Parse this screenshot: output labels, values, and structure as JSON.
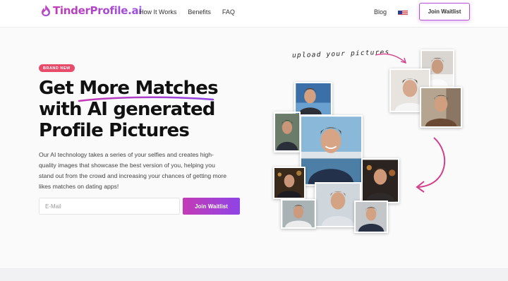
{
  "brand": {
    "name": "TinderProfile.ai",
    "color": "#b44fd8"
  },
  "nav": {
    "how": "How It Works",
    "benefits": "Benefits",
    "faq": "FAQ",
    "blog": "Blog"
  },
  "header": {
    "cta": "Join Waitlist",
    "language_icon": "us-flag-icon"
  },
  "hero": {
    "badge": "BRAND NEW",
    "headline_line1": "Get More Matches",
    "headline_line2": "with AI generated",
    "headline_line3": "Profile Pictures",
    "description": "Our AI technology takes a series of your selfies and creates high-quality images that showcase the best version of you, helping you stand out from the crowd and increasing your chances of getting more likes matches on dating apps!",
    "email_placeholder": "E-Mail",
    "cta": "Join Waitlist"
  },
  "collage": {
    "upload_label": "upload your pictures"
  },
  "colors": {
    "accent_pink": "#c43bb5",
    "accent_purple": "#8f44e6",
    "badge": "#e94b6a"
  }
}
